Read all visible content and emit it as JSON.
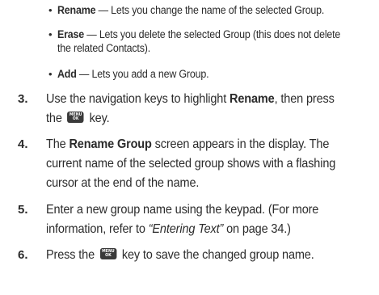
{
  "bullets": [
    {
      "term": "Rename",
      "dash": " — ",
      "desc": "Lets you change the name of the selected Group."
    },
    {
      "term": "Erase",
      "dash": " — ",
      "desc_line1": "Lets you delete the selected Group (this does not delete",
      "desc_line2": "the related Contacts)."
    },
    {
      "term": "Add",
      "dash": " — ",
      "desc": "Lets you add a new Group."
    }
  ],
  "bullet_symbol": "•",
  "key": {
    "label_top": "MENU",
    "label_bottom": "OK"
  },
  "steps": [
    {
      "num": "3.",
      "l1_a": "Use the navigation keys to highlight ",
      "l1_b": "Rename",
      "l1_c": ", then press",
      "l2_a": "the",
      "l2_b": " key."
    },
    {
      "num": "4.",
      "l1_a": "The ",
      "l1_b": "Rename Group",
      "l1_c": " screen appears in the display. The",
      "l2": "current name of the selected group shows with a flashing",
      "l3": "cursor at the end of the name."
    },
    {
      "num": "5.",
      "l1": "Enter a new group name using the keypad. (For more",
      "l2_a": "information, refer to ",
      "l2_b": "“Entering Text”",
      "l2_c": " on page 34.)"
    },
    {
      "num": "6.",
      "l1_a": "Press the",
      "l1_b": " key to save the changed group name."
    }
  ]
}
